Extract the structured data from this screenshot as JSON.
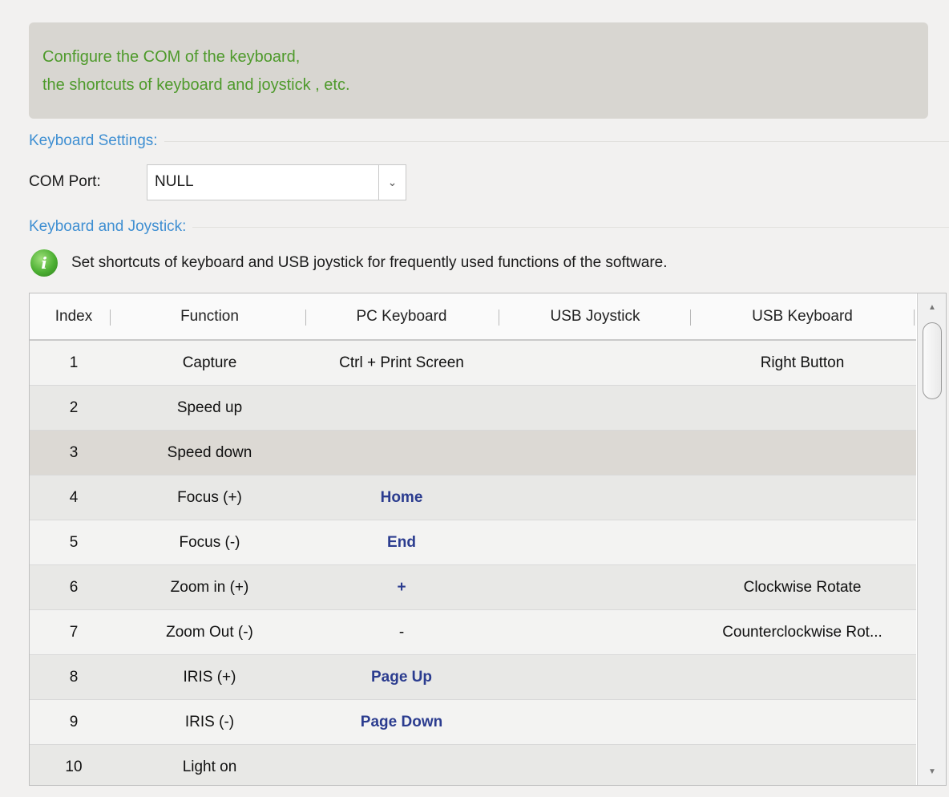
{
  "banner": {
    "line1": "Configure the COM of the keyboard,",
    "line2": "the shortcuts of keyboard and joystick , etc."
  },
  "keyboard_settings": {
    "title": "Keyboard Settings:",
    "com_port_label": "COM Port:",
    "com_port_value": "NULL"
  },
  "keyboard_joystick": {
    "title": "Keyboard and Joystick:",
    "hint": "Set shortcuts of keyboard and USB joystick for frequently used functions of the software."
  },
  "table": {
    "columns": [
      "Index",
      "Function",
      "PC Keyboard",
      "USB Joystick",
      "USB Keyboard"
    ],
    "selected_row_index": 3,
    "rows": [
      {
        "index": "1",
        "function": "Capture",
        "pc_keyboard": "Ctrl + Print Screen",
        "usb_joystick": "",
        "usb_keyboard": "Right Button"
      },
      {
        "index": "2",
        "function": "Speed up",
        "pc_keyboard": "",
        "usb_joystick": "",
        "usb_keyboard": ""
      },
      {
        "index": "3",
        "function": "Speed down",
        "pc_keyboard": "",
        "usb_joystick": "",
        "usb_keyboard": ""
      },
      {
        "index": "4",
        "function": "Focus (+)",
        "pc_keyboard": "Home",
        "usb_joystick": "",
        "usb_keyboard": ""
      },
      {
        "index": "5",
        "function": "Focus (-)",
        "pc_keyboard": "End",
        "usb_joystick": "",
        "usb_keyboard": ""
      },
      {
        "index": "6",
        "function": "Zoom in (+)",
        "pc_keyboard": "+",
        "usb_joystick": "",
        "usb_keyboard": "Clockwise Rotate"
      },
      {
        "index": "7",
        "function": "Zoom Out (-)",
        "pc_keyboard": "-",
        "usb_joystick": "",
        "usb_keyboard": "Counterclockwise Rot..."
      },
      {
        "index": "8",
        "function": "IRIS (+)",
        "pc_keyboard": "Page Up",
        "usb_joystick": "",
        "usb_keyboard": ""
      },
      {
        "index": "9",
        "function": "IRIS (-)",
        "pc_keyboard": "Page Down",
        "usb_joystick": "",
        "usb_keyboard": ""
      },
      {
        "index": "10",
        "function": "Light on",
        "pc_keyboard": "",
        "usb_joystick": "",
        "usb_keyboard": ""
      }
    ],
    "bold_pc_keys": [
      "Home",
      "End",
      "+",
      "Page Up",
      "Page Down"
    ]
  },
  "icons": {
    "info": "info-icon",
    "dropdown": "chevron-down-icon",
    "scroll_up": "arrow-up-icon",
    "scroll_down": "arrow-down-icon"
  },
  "colors": {
    "banner_text": "#4e9a2b",
    "section_title": "#3f8fd2",
    "key_text": "#2b3c8f",
    "selected_row": "#dcd9d4"
  }
}
